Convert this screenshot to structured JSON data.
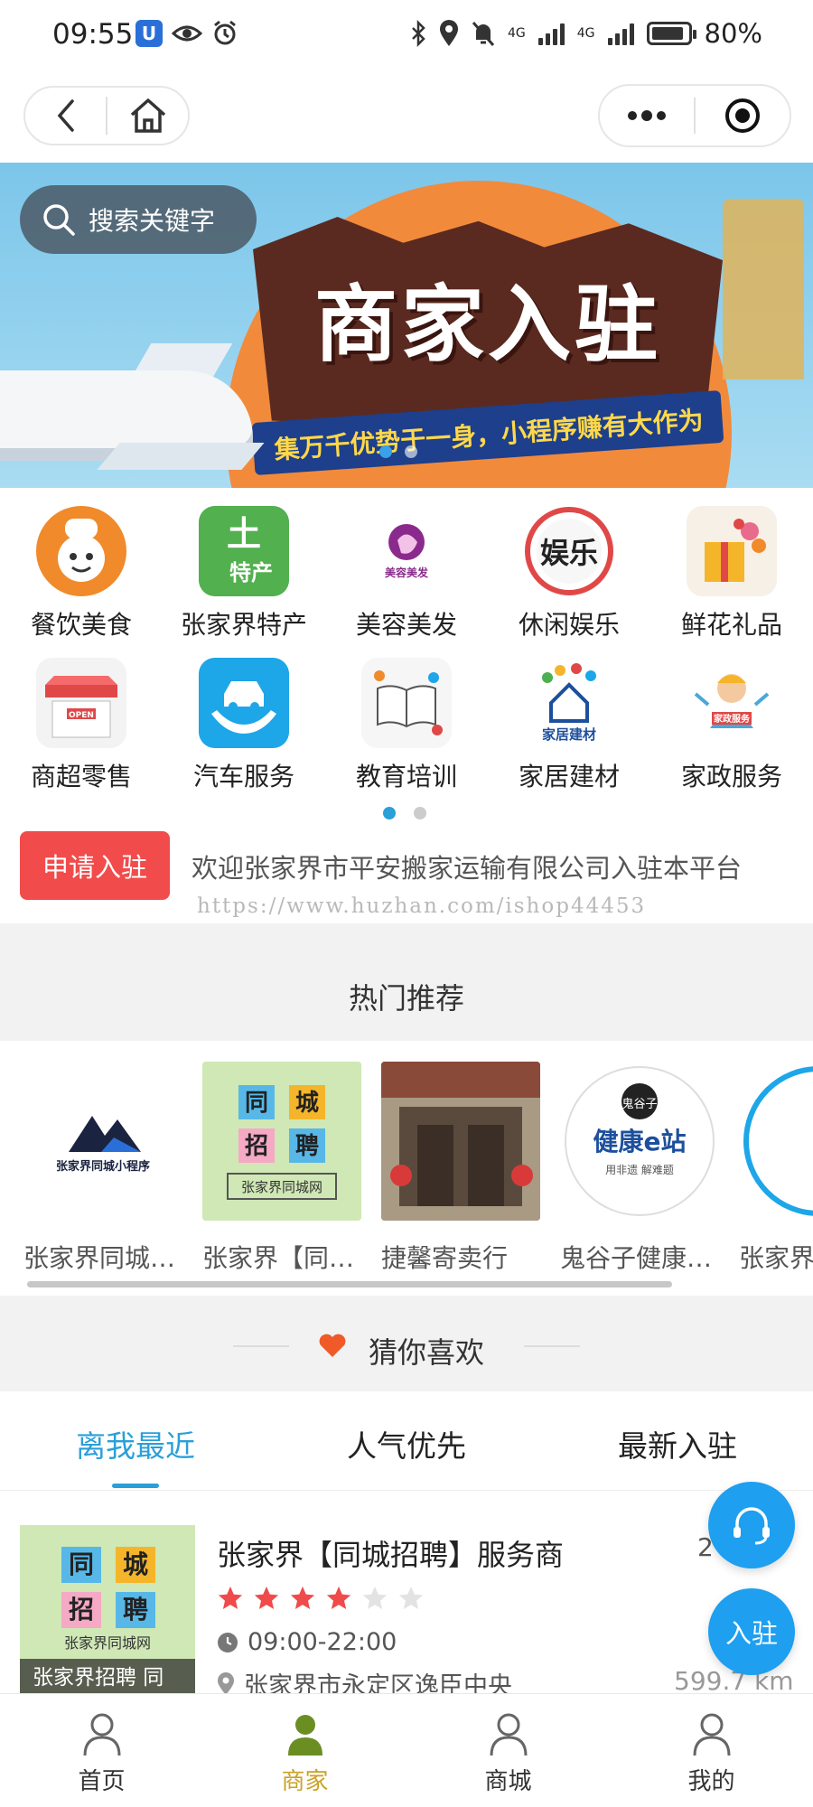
{
  "status_bar": {
    "time": "09:55",
    "battery": "80%",
    "network_1": "4G",
    "network_2": "4G"
  },
  "nav": {
    "back_icon": "chevron-left-icon",
    "home_icon": "home-icon",
    "more_icon": "more-dots-icon",
    "close_icon": "target-icon"
  },
  "banner": {
    "search_placeholder": "搜索关键字",
    "title": "商家入驻",
    "slogan": "集万千优势于一身，小程序赚有大作为",
    "slide_count": 2,
    "active_slide": 1
  },
  "categories": {
    "rows": [
      [
        {
          "label": "餐饮美食",
          "icon": "chef-icon",
          "color": "#f08a2a",
          "glyph": "餐饮"
        },
        {
          "label": "张家界特产",
          "icon": "local-specialty-icon",
          "color": "#4caf50",
          "glyph": "土特产"
        },
        {
          "label": "美容美发",
          "icon": "beauty-icon",
          "color": "#ffffff",
          "glyph": "美容美发"
        },
        {
          "label": "休闲娱乐",
          "icon": "entertainment-icon",
          "color": "#ffffff",
          "glyph": "娱乐"
        },
        {
          "label": "鲜花礼品",
          "icon": "gift-icon",
          "color": "#f5e6d0",
          "glyph": "礼"
        }
      ],
      [
        {
          "label": "商超零售",
          "icon": "shop-icon",
          "color": "#f3f3f3",
          "glyph": "OPEN"
        },
        {
          "label": "汽车服务",
          "icon": "car-service-icon",
          "color": "#1da6e8",
          "glyph": "车"
        },
        {
          "label": "教育培训",
          "icon": "education-icon",
          "color": "#f6f6f6",
          "glyph": "书"
        },
        {
          "label": "家居建材",
          "icon": "home-building-icon",
          "color": "#ffffff",
          "glyph": "家居建材"
        },
        {
          "label": "家政服务",
          "icon": "housekeeping-icon",
          "color": "#ffffff",
          "glyph": "家政服务"
        }
      ]
    ],
    "page_count": 2,
    "active_page": 1
  },
  "apply": {
    "button_label": "申请入驻",
    "notice": "欢迎张家界市平安搬家运输有限公司入驻本平台",
    "watermark": "https://www.huzhan.com/ishop44453"
  },
  "hot": {
    "title": "热门推荐",
    "items": [
      {
        "name": "张家界同城小程序"
      },
      {
        "name": "张家界【同城招聘】服务商"
      },
      {
        "name": "捷馨寄卖行"
      },
      {
        "name": "鬼谷子健康e站"
      },
      {
        "name": "张家界"
      }
    ],
    "logo_text": "张家界同城小程序",
    "recruit_chars": [
      "同",
      "城",
      "招",
      "聘"
    ],
    "recruit_caption": "张家界同城网",
    "guigu_brand": "健康e站",
    "guigu_top": "鬼谷子",
    "guigu_sub": "用非遗 解难题"
  },
  "guess": {
    "title": "猜你喜欢",
    "heart_icon": "heart-icon"
  },
  "tabs": [
    {
      "label": "离我最近",
      "active": true
    },
    {
      "label": "人气优先",
      "active": false
    },
    {
      "label": "最新入驻",
      "active": false
    }
  ],
  "store": {
    "name": "张家界【同城招聘】服务商",
    "thumb_label": "张家界招聘 同",
    "rating": 4,
    "rating_max": 6,
    "hours": "09:00-22:00",
    "address": "张家界市永定区逸臣中央",
    "count": "2",
    "distance": "599.7 km"
  },
  "fab": {
    "service_icon": "headset-icon",
    "join_label": "入驻"
  },
  "tabbar": [
    {
      "label": "首页",
      "icon": "user-icon",
      "active": false
    },
    {
      "label": "商家",
      "icon": "user-icon",
      "active": true
    },
    {
      "label": "商城",
      "icon": "user-icon",
      "active": false
    },
    {
      "label": "我的",
      "icon": "user-icon",
      "active": false
    }
  ],
  "colors": {
    "accent": "#2a9fd8",
    "apply_red": "#f24b4b",
    "star_red": "#f04a4a",
    "tab_active_gold": "#c9a227",
    "fab_blue": "#1e9ff0"
  }
}
